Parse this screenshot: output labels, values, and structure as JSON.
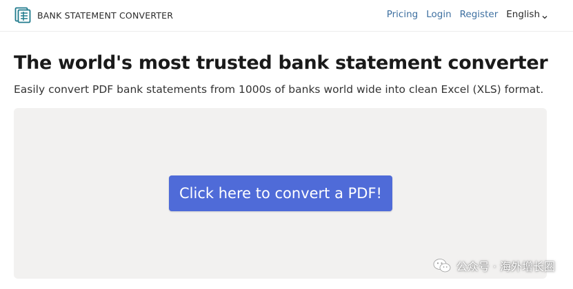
{
  "header": {
    "brand_name": "BANK STATEMENT CONVERTER",
    "nav": {
      "pricing": "Pricing",
      "login": "Login",
      "register": "Register",
      "language": "English"
    }
  },
  "hero": {
    "title": "The world's most trusted bank statement converter",
    "subtitle": "Easily convert PDF bank statements from 1000s of banks world wide into clean Excel (XLS) format."
  },
  "dropzone": {
    "button_label": "Click here to convert a PDF!"
  },
  "watermark": {
    "text": "公众号 · 海外增长圈"
  },
  "colors": {
    "accent": "#4f6bd8",
    "link": "#3d6fa0",
    "dropzone_bg": "#f2f1f0",
    "logo": "#1f7a8c"
  },
  "icons": {
    "logo": "document-table-icon",
    "language_caret": "chevron-down-icon",
    "watermark": "wechat-icon"
  }
}
